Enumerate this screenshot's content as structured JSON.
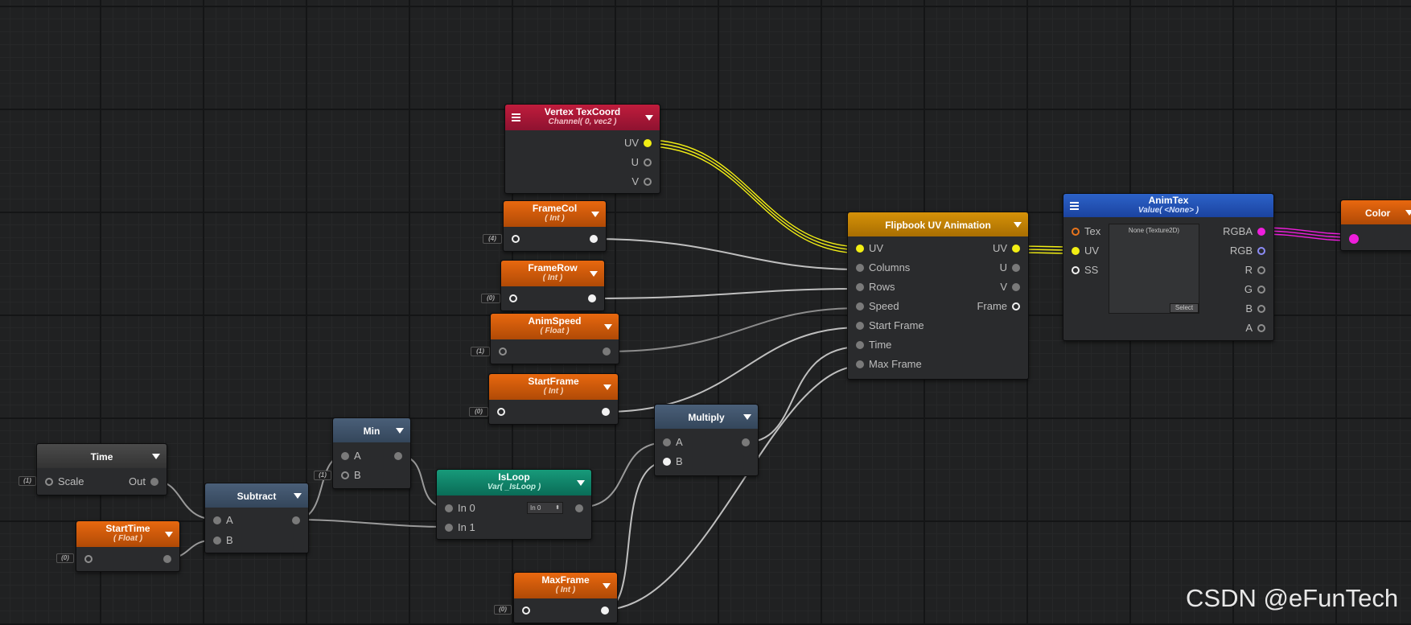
{
  "nodes": {
    "vertex_texcoord": {
      "title": "Vertex TexCoord",
      "subtitle": "Channel( 0, vec2 )",
      "outputs": [
        "UV",
        "U",
        "V"
      ]
    },
    "frame_col": {
      "title": "FrameCol",
      "subtitle": "( Int )",
      "default": "(4)"
    },
    "frame_row": {
      "title": "FrameRow",
      "subtitle": "( Int )",
      "default": "(0)"
    },
    "anim_speed": {
      "title": "AnimSpeed",
      "subtitle": "( Float )",
      "default": "(1)"
    },
    "start_frame": {
      "title": "StartFrame",
      "subtitle": "( Int )",
      "default": "(0)"
    },
    "flipbook": {
      "title": "Flipbook UV Animation",
      "inputs": [
        "UV",
        "Columns",
        "Rows",
        "Speed",
        "Start Frame",
        "Time",
        "Max Frame"
      ],
      "outputs": [
        "UV",
        "U",
        "V",
        "Frame"
      ]
    },
    "anim_tex": {
      "title": "AnimTex",
      "subtitle": "Value( <None> )",
      "inputs": [
        "Tex",
        "UV",
        "SS"
      ],
      "outputs": [
        "RGBA",
        "RGB",
        "R",
        "G",
        "B",
        "A"
      ],
      "texture_label": "None (Texture2D)",
      "select_label": "Select"
    },
    "color": {
      "title": "Color"
    },
    "multiply": {
      "title": "Multiply",
      "inputs": [
        "A",
        "B"
      ]
    },
    "min": {
      "title": "Min",
      "inputs": [
        "A",
        "B"
      ],
      "default_b": "(1)"
    },
    "time": {
      "title": "Time",
      "input": "Scale",
      "output": "Out",
      "default": "(1)"
    },
    "subtract": {
      "title": "Subtract",
      "inputs": [
        "A",
        "B"
      ]
    },
    "start_time": {
      "title": "StartTime",
      "subtitle": "( Float )",
      "default": "(0)"
    },
    "is_loop": {
      "title": "IsLoop",
      "subtitle": "Var( _IsLoop )",
      "inputs": [
        "In 0",
        "In 1"
      ],
      "dropdown_value": "In 0"
    },
    "max_frame": {
      "title": "MaxFrame",
      "subtitle": "( Int )",
      "default": "(0)"
    }
  },
  "watermark": "CSDN @eFunTech",
  "colors": {
    "background": "#202122",
    "wire_default": "#bfbfbf",
    "wire_uv": "#f2ee14",
    "wire_rgba": "#ef1edc",
    "property_header": "#d85e0c",
    "vertex_header": "#b0183a",
    "flipbook_header": "#c78606",
    "texture_header": "#2556b8",
    "var_header": "#12856a",
    "math_header": "#41556c"
  },
  "icons": [
    "menu-icon",
    "dropdown-arrow-icon",
    "port-pin-icon"
  ]
}
